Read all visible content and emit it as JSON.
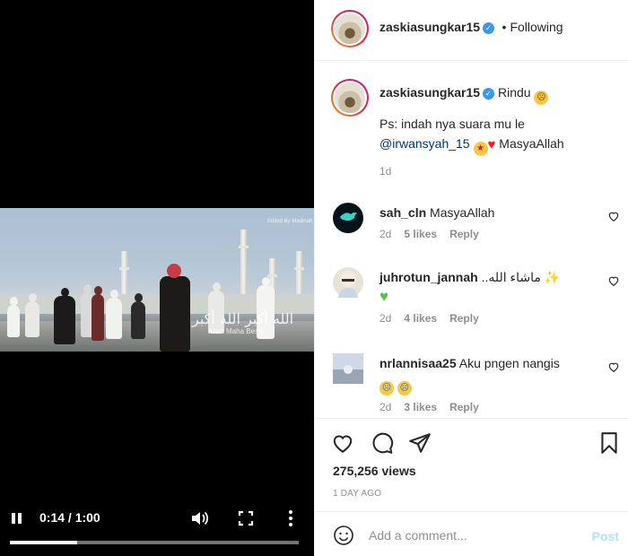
{
  "post_header": {
    "username": "zaskiasungkar15",
    "separator": "•",
    "follow_status": "Following"
  },
  "caption": {
    "username": "zaskiasungkar15",
    "text": "Rindu",
    "line2": "Ps: indah nya suara mu le",
    "mention": "@irwansyah_15",
    "line3_tail": "MasyaAllah",
    "age": "1d"
  },
  "comments": [
    {
      "username": "sah_cln",
      "text": "MasyaAllah",
      "age": "2d",
      "likes": "5 likes",
      "reply": "Reply",
      "avatar_color": "#06121a"
    },
    {
      "username": "juhrotun_jannah",
      "text": "..ماشاء الله",
      "age": "2d",
      "likes": "4 likes",
      "reply": "Reply",
      "avatar_color": "#e7e3da"
    },
    {
      "username": "nrlannisaa25",
      "text": "Aku pngen nangis",
      "age": "2d",
      "likes": "3 likes",
      "reply": "Reply",
      "avatar_color": "#b9c2d0"
    }
  ],
  "stats": {
    "views": "275,256 views",
    "posted": "1 DAY AGO"
  },
  "add_comment": {
    "placeholder": "Add a comment...",
    "post_label": "Post"
  },
  "video": {
    "time": "0:14 / 1:00",
    "progress_fraction": 0.233,
    "watermark_top": "Edited By Madinah",
    "watermark_arabic": "الله أكبر الله أكبر",
    "watermark_latin": "Allah Maha Besar"
  },
  "icons": {
    "verified": "verified-badge-icon",
    "like": "heart-icon",
    "comment": "comment-bubble-icon",
    "share": "paper-plane-icon",
    "save": "bookmark-icon",
    "emoji": "smiley-icon",
    "play": "pause-icon",
    "volume": "volume-icon",
    "fullscreen": "fullscreen-icon",
    "more": "more-vertical-icon"
  },
  "colors": {
    "accent": "#3897f0",
    "link": "#00376b",
    "muted": "#8e8e8e"
  }
}
